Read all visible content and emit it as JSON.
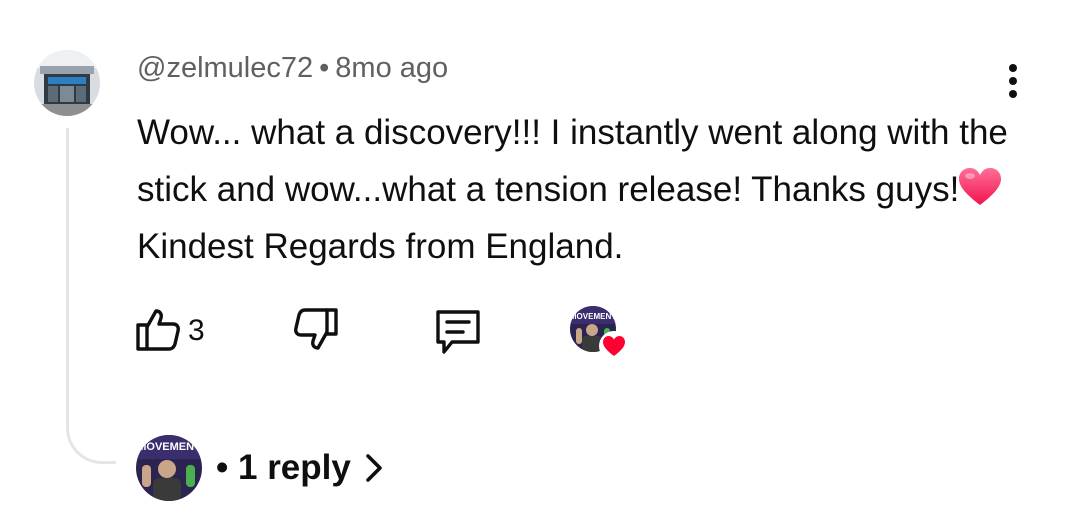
{
  "comment": {
    "author": "@zelmulec72",
    "separator": "•",
    "time": "8mo ago",
    "text_part1": "Wow... what a discovery!!! I instantly went along with the stick and wow...what a tension release! Thanks guys!",
    "emoji": "heart-emoji",
    "text_part2": " Kindest Regards from England.",
    "likes": "3"
  },
  "actions": {
    "like_icon": "thumbs-up-icon",
    "dislike_icon": "thumbs-down-icon",
    "reply_icon": "reply-comment-icon",
    "menu_icon": "more-vert-icon"
  },
  "creator_heart": {
    "avatar_text": "MOVEMENT",
    "badge_icon": "heart-icon",
    "badge_color": "#ff0033"
  },
  "replies": {
    "avatar_text": "MOVEMENT",
    "separator": "•",
    "label": "1 reply"
  },
  "colors": {
    "text_primary": "#0f0f0f",
    "text_secondary": "#606060",
    "thread_line": "#e5e5e5",
    "heart": "#ff2d6f"
  }
}
